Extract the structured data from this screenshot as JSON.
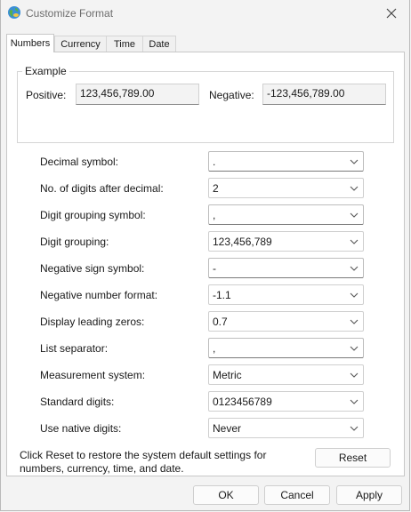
{
  "window": {
    "title": "Customize Format"
  },
  "tabs": [
    {
      "label": "Numbers",
      "active": true
    },
    {
      "label": "Currency",
      "active": false
    },
    {
      "label": "Time",
      "active": false
    },
    {
      "label": "Date",
      "active": false
    }
  ],
  "example": {
    "group_label": "Example",
    "positive_label": "Positive:",
    "positive_value": "123,456,789.00",
    "negative_label": "Negative:",
    "negative_value": "-123,456,789.00"
  },
  "settings": [
    {
      "label": "Decimal symbol:",
      "value": ".",
      "editable": true
    },
    {
      "label": "No. of digits after decimal:",
      "value": "2",
      "editable": false
    },
    {
      "label": "Digit grouping symbol:",
      "value": ",",
      "editable": true
    },
    {
      "label": "Digit grouping:",
      "value": "123,456,789",
      "editable": false
    },
    {
      "label": "Negative sign symbol:",
      "value": "-",
      "editable": true
    },
    {
      "label": "Negative number format:",
      "value": "-1.1",
      "editable": false
    },
    {
      "label": "Display leading zeros:",
      "value": "0.7",
      "editable": false
    },
    {
      "label": "List separator:",
      "value": ",",
      "editable": true
    },
    {
      "label": "Measurement system:",
      "value": "Metric",
      "editable": false
    },
    {
      "label": "Standard digits:",
      "value": "0123456789",
      "editable": false
    },
    {
      "label": "Use native digits:",
      "value": "Never",
      "editable": false
    }
  ],
  "reset_text": "Click Reset to restore the system default settings for numbers, currency, time, and date.",
  "buttons": {
    "reset": "Reset",
    "ok": "OK",
    "cancel": "Cancel",
    "apply": "Apply"
  },
  "icons": {
    "app": "globe-icon",
    "close": "close-icon",
    "dropdown": "chevron-down-icon"
  },
  "colors": {
    "window_bg": "#f3f3f3",
    "panel_bg": "#ffffff",
    "border": "#c7c7c7"
  }
}
